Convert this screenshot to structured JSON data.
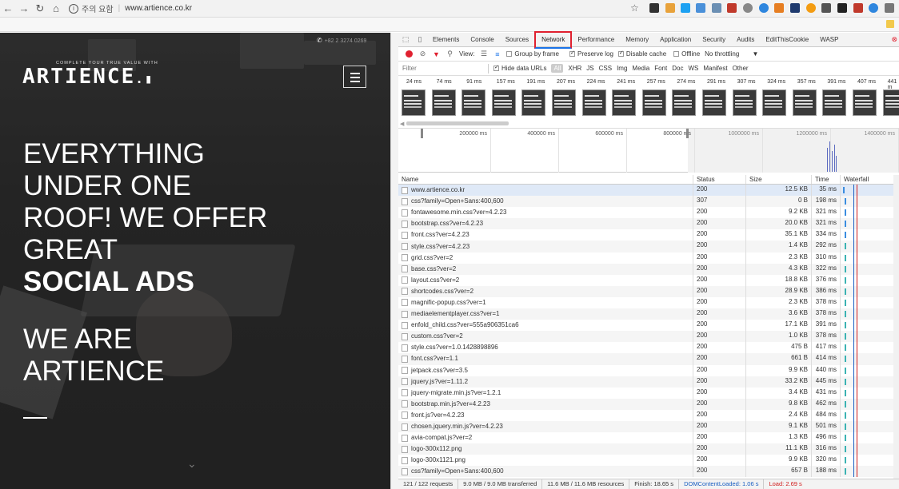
{
  "browser": {
    "url_warning": "주의 요함",
    "url": "www.artience.co.kr"
  },
  "site": {
    "phone": "+82 2 3274 0269",
    "tagline": "COMPLETE YOUR TRUE VALUE WITH",
    "logo": "ARTIENCE",
    "headline_lines": [
      "EVERYTHING",
      "UNDER ONE",
      "ROOF! WE OFFER",
      "GREAT"
    ],
    "headline_bold": "SOCIAL ADS",
    "we_are_lines": [
      "WE ARE",
      "ARTIENCE"
    ]
  },
  "devtools": {
    "tabs": [
      "Elements",
      "Console",
      "Sources",
      "Network",
      "Performance",
      "Memory",
      "Application",
      "Security",
      "Audits",
      "EditThisCookie",
      "WASP"
    ],
    "active_tab": "Network",
    "toolbar": {
      "view_label": "View:",
      "group_by_frame": "Group by frame",
      "preserve_log": "Preserve log",
      "disable_cache": "Disable cache",
      "offline": "Offline",
      "throttling": "No throttling"
    },
    "filter": {
      "placeholder": "Filter",
      "hide_data_urls": "Hide data URLs",
      "types": [
        "All",
        "XHR",
        "JS",
        "CSS",
        "Img",
        "Media",
        "Font",
        "Doc",
        "WS",
        "Manifest",
        "Other"
      ]
    },
    "filmstrip_times": [
      "24 ms",
      "74 ms",
      "91 ms",
      "157 ms",
      "191 ms",
      "207 ms",
      "224 ms",
      "241 ms",
      "257 ms",
      "274 ms",
      "291 ms",
      "307 ms",
      "324 ms",
      "357 ms",
      "391 ms",
      "407 ms",
      "441 m"
    ],
    "overview_labels": [
      "200000 ms",
      "400000 ms",
      "600000 ms",
      "800000 ms",
      "1000000 ms",
      "1200000 ms",
      "1400000 ms"
    ],
    "columns": [
      "Name",
      "Status",
      "Size",
      "Time",
      "Waterfall"
    ],
    "rows": [
      {
        "name": "www.artience.co.kr",
        "status": "200",
        "size": "12.5 KB",
        "time": "35 ms"
      },
      {
        "name": "css?family=Open+Sans:400,600",
        "status": "307",
        "size": "0 B",
        "time": "198 ms"
      },
      {
        "name": "fontawesome.min.css?ver=4.2.23",
        "status": "200",
        "size": "9.2 KB",
        "time": "321 ms"
      },
      {
        "name": "bootstrap.css?ver=4.2.23",
        "status": "200",
        "size": "20.0 KB",
        "time": "321 ms"
      },
      {
        "name": "front.css?ver=4.2.23",
        "status": "200",
        "size": "35.1 KB",
        "time": "334 ms"
      },
      {
        "name": "style.css?ver=4.2.23",
        "status": "200",
        "size": "1.4 KB",
        "time": "292 ms"
      },
      {
        "name": "grid.css?ver=2",
        "status": "200",
        "size": "2.3 KB",
        "time": "310 ms"
      },
      {
        "name": "base.css?ver=2",
        "status": "200",
        "size": "4.3 KB",
        "time": "322 ms"
      },
      {
        "name": "layout.css?ver=2",
        "status": "200",
        "size": "18.8 KB",
        "time": "376 ms"
      },
      {
        "name": "shortcodes.css?ver=2",
        "status": "200",
        "size": "28.9 KB",
        "time": "386 ms"
      },
      {
        "name": "magnific-popup.css?ver=1",
        "status": "200",
        "size": "2.3 KB",
        "time": "378 ms"
      },
      {
        "name": "mediaelementplayer.css?ver=1",
        "status": "200",
        "size": "3.6 KB",
        "time": "378 ms"
      },
      {
        "name": "enfold_child.css?ver=555a906351ca6",
        "status": "200",
        "size": "17.1 KB",
        "time": "391 ms"
      },
      {
        "name": "custom.css?ver=2",
        "status": "200",
        "size": "1.0 KB",
        "time": "378 ms"
      },
      {
        "name": "style.css?ver=1.0.1428898896",
        "status": "200",
        "size": "475 B",
        "time": "417 ms"
      },
      {
        "name": "font.css?ver=1.1",
        "status": "200",
        "size": "661 B",
        "time": "414 ms"
      },
      {
        "name": "jetpack.css?ver=3.5",
        "status": "200",
        "size": "9.9 KB",
        "time": "440 ms"
      },
      {
        "name": "jquery.js?ver=1.11.2",
        "status": "200",
        "size": "33.2 KB",
        "time": "445 ms"
      },
      {
        "name": "jquery-migrate.min.js?ver=1.2.1",
        "status": "200",
        "size": "3.4 KB",
        "time": "431 ms"
      },
      {
        "name": "bootstrap.min.js?ver=4.2.23",
        "status": "200",
        "size": "9.8 KB",
        "time": "462 ms"
      },
      {
        "name": "front.js?ver=4.2.23",
        "status": "200",
        "size": "2.4 KB",
        "time": "484 ms"
      },
      {
        "name": "chosen.jquery.min.js?ver=4.2.23",
        "status": "200",
        "size": "9.1 KB",
        "time": "501 ms"
      },
      {
        "name": "avia-compat.js?ver=2",
        "status": "200",
        "size": "1.3 KB",
        "time": "496 ms"
      },
      {
        "name": "logo-300x112.png",
        "status": "200",
        "size": "11.1 KB",
        "time": "316 ms"
      },
      {
        "name": "logo-300x1121.png",
        "status": "200",
        "size": "9.9 KB",
        "time": "320 ms"
      },
      {
        "name": "css?family=Open+Sans:400,600",
        "status": "200",
        "size": "657 B",
        "time": "188 ms"
      }
    ],
    "status_bar": {
      "requests": "121 / 122 requests",
      "transferred": "9.0 MB / 9.0 MB transferred",
      "resources": "11.6 MB / 11.6 MB resources",
      "finish": "Finish: 18.65 s",
      "dom_loaded": "DOMContentLoaded: 1.06 s",
      "load": "Load: 2.69 s"
    }
  },
  "colors": {
    "record": "#e0202f",
    "highlight_box": "#e0202f",
    "dom_loaded": "#1a5fc2",
    "load": "#d01c1c"
  }
}
